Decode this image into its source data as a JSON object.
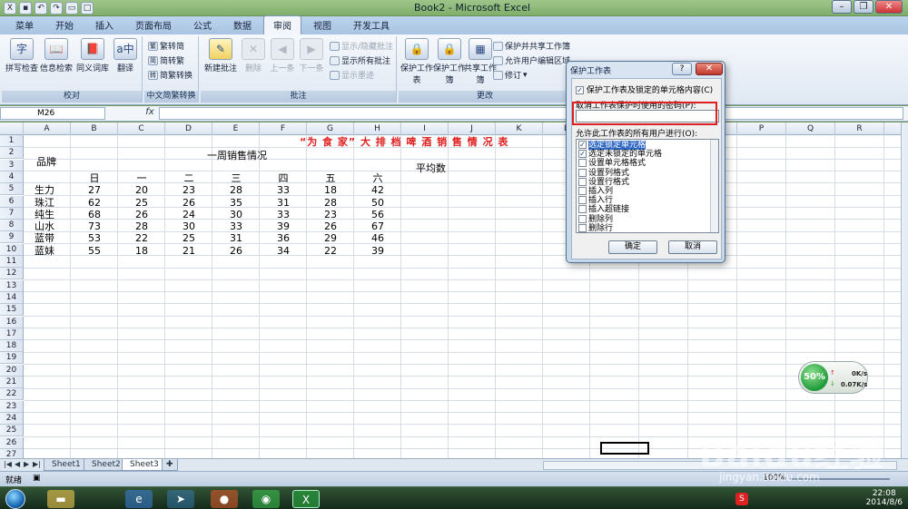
{
  "window": {
    "title": "Book2 - Microsoft Excel",
    "qat_icons": [
      "excel-icon",
      "save-icon",
      "undo-icon",
      "redo-icon",
      "open-icon",
      "new-icon"
    ],
    "controls": {
      "minimize": "–",
      "restore": "❐",
      "close": "✕"
    }
  },
  "ribbon": {
    "tabs": [
      "菜单",
      "开始",
      "插入",
      "页面布局",
      "公式",
      "数据",
      "审阅",
      "视图",
      "开发工具"
    ],
    "active_tab": "审阅",
    "groups": {
      "proofing": {
        "label": "校对",
        "buttons": [
          "拼写检查",
          "信息检索",
          "同义词库",
          "翻译"
        ]
      },
      "chinese": {
        "label": "中文简繁转换",
        "buttons": [
          "繁转简",
          "简转繁",
          "简繁转换"
        ]
      },
      "comments": {
        "label": "批注",
        "buttons": [
          "新建批注",
          "删除",
          "上一条",
          "下一条"
        ],
        "small": [
          "显示/隐藏批注",
          "显示所有批注",
          "显示墨迹"
        ]
      },
      "changes": {
        "label": "更改",
        "buttons": [
          "保护工作表",
          "保护工作簿",
          "共享工作簿"
        ],
        "small": [
          "保护并共享工作簿",
          "允许用户编辑区域",
          "修订"
        ]
      }
    }
  },
  "formula_bar": {
    "name_box": "M26",
    "fx": "fx",
    "value": ""
  },
  "sheet": {
    "columns": [
      "A",
      "B",
      "C",
      "D",
      "E",
      "F",
      "G",
      "H",
      "I",
      "J",
      "K",
      "L",
      "M",
      "N",
      "O",
      "P",
      "Q",
      "R"
    ],
    "rows": [
      "1",
      "2",
      "3",
      "4",
      "5",
      "6",
      "7",
      "8",
      "9",
      "10",
      "11",
      "12",
      "13",
      "14",
      "15",
      "16",
      "17",
      "18",
      "19",
      "20",
      "21",
      "22",
      "23",
      "24",
      "25",
      "26",
      "27"
    ],
    "title": "“为 食 家” 大 排 档 啤 酒 销 售 情 况 表",
    "brand_header": "品牌",
    "week_header": "一周销售情况",
    "days": [
      "日",
      "一",
      "二",
      "三",
      "四",
      "五",
      "六"
    ],
    "avg_header": "平均数",
    "data_rows": [
      {
        "brand": "生力",
        "values": [
          "27",
          "20",
          "23",
          "28",
          "33",
          "18",
          "42"
        ]
      },
      {
        "brand": "珠江",
        "values": [
          "62",
          "25",
          "26",
          "35",
          "31",
          "28",
          "50"
        ]
      },
      {
        "brand": "纯生",
        "values": [
          "68",
          "26",
          "24",
          "30",
          "33",
          "23",
          "56"
        ]
      },
      {
        "brand": "山水",
        "values": [
          "73",
          "28",
          "30",
          "33",
          "39",
          "26",
          "67"
        ]
      },
      {
        "brand": "蓝带",
        "values": [
          "53",
          "22",
          "25",
          "31",
          "36",
          "29",
          "46"
        ]
      },
      {
        "brand": "蓝妹",
        "values": [
          "55",
          "18",
          "21",
          "26",
          "34",
          "22",
          "39"
        ]
      }
    ],
    "tabs": [
      "Sheet1",
      "Sheet2",
      "Sheet3"
    ],
    "active_tab": "Sheet3"
  },
  "status": {
    "text": "就绪",
    "zoom": "100%"
  },
  "dialog": {
    "title": "保护工作表",
    "help": "?",
    "close": "✕",
    "protect_checkbox": "保护工作表及锁定的单元格内容(C)",
    "password_label": "取消工作表保护时使用的密码(P):",
    "allow_label": "允许此工作表的所有用户进行(O):",
    "permissions": [
      {
        "label": "选定锁定单元格",
        "checked": true,
        "selected": true
      },
      {
        "label": "选定未锁定的单元格",
        "checked": true,
        "selected": false
      },
      {
        "label": "设置单元格格式",
        "checked": false,
        "selected": false
      },
      {
        "label": "设置列格式",
        "checked": false,
        "selected": false
      },
      {
        "label": "设置行格式",
        "checked": false,
        "selected": false
      },
      {
        "label": "插入列",
        "checked": false,
        "selected": false
      },
      {
        "label": "插入行",
        "checked": false,
        "selected": false
      },
      {
        "label": "插入超链接",
        "checked": false,
        "selected": false
      },
      {
        "label": "删除列",
        "checked": false,
        "selected": false
      },
      {
        "label": "删除行",
        "checked": false,
        "selected": false
      }
    ],
    "ok": "确定",
    "cancel": "取消"
  },
  "net_widget": {
    "percent": "50%",
    "up": "0K/s",
    "down": "0.07K/s"
  },
  "taskbar": {
    "time": "22:08",
    "date": "2014/8/6"
  },
  "watermark": {
    "main": "Baidu经验",
    "url": "jingyan.baidu.com"
  }
}
